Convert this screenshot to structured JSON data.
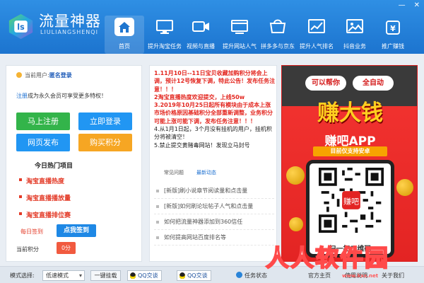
{
  "app": {
    "title": "流量神器",
    "subtitle": "LIULIANGSHENQI",
    "window_buttons": [
      "—",
      "✕"
    ]
  },
  "nav": [
    {
      "label": "首页",
      "icon": "home-icon"
    },
    {
      "label": "提升淘宝任务",
      "icon": "monitor-icon"
    },
    {
      "label": "视频与直播",
      "icon": "video-icon"
    },
    {
      "label": "提升网站人气",
      "icon": "website-icon"
    },
    {
      "label": "拼多多与京东",
      "icon": "shop-icon"
    },
    {
      "label": "提升人气排名",
      "icon": "ranking-icon"
    },
    {
      "label": "抖音业务",
      "icon": "douyin-icon"
    },
    {
      "label": "推广赚钱",
      "icon": "promote-icon"
    }
  ],
  "user": {
    "current_user_label": "当前用户:",
    "user_name": "匿名登录",
    "register_link": "注册",
    "register_tip": "成为永久会员可享受更多特权！"
  },
  "actions": {
    "register": "马上注册",
    "login": "立即登录",
    "publish": "网页发布",
    "buy_points": "购买积分"
  },
  "hot": {
    "title": "今日热门项目",
    "items": [
      "淘宝直播热度",
      "淘宝直播播放量",
      "淘宝直播排位赛"
    ]
  },
  "sign": {
    "label": "每日签到",
    "button": "点我签到"
  },
  "points": {
    "label": "当前积分",
    "value": "0分"
  },
  "notice": {
    "lines": [
      "1.11月10日--11日宝贝收藏加购积分将会上调，预计12号恢复下调，特此公告！发布任务注意！！！",
      "2淘宝直播热度欢迎提交，上线50w",
      "3.2019年10月25日起所有模块由于成本上涨市场价格原因基础积分全部重新调整，业务积分可能上涨可能下调，发布任务注意！！！",
      "4.从1月1日起，3个月没有挂机的用户，挂机积分将被清空！",
      "5.禁止提交黄赌毒网站！发现立马封号"
    ],
    "tabs": [
      "常见问题",
      "最新动态"
    ]
  },
  "news": [
    "[新版]刷小说章节阅读量和点击量",
    "[新版]如何刷论坛帖子人气和点击量",
    "如何把流量神器添加到360信任",
    "如何提高网站百度排名等"
  ],
  "ad": {
    "bubble_left": "可以帮你",
    "bubble_right": "全自动",
    "headline": "赚大钱",
    "app_name": "赚吧APP",
    "ribbon": "目前仅支持安卓",
    "scan": "扫一扫二维码",
    "logo": "赚吧"
  },
  "statusbar": {
    "mode_label": "模式选择:",
    "mode_value": "低速模式",
    "hang_button": "一键挂载",
    "qq1": "QQ交谈",
    "qq2": "QQ交谈",
    "task_status": "任务状态",
    "right_items": [
      "官方主页",
      "使用说明",
      "关于我们"
    ]
  },
  "watermark": {
    "text": "人人软件园",
    "url": "www.kxx.net"
  },
  "colors": {
    "header": "#1c74cf",
    "green": "#33b44a",
    "blue": "#2196f3",
    "orange": "#f6a623",
    "red_text": "#e3261f"
  }
}
